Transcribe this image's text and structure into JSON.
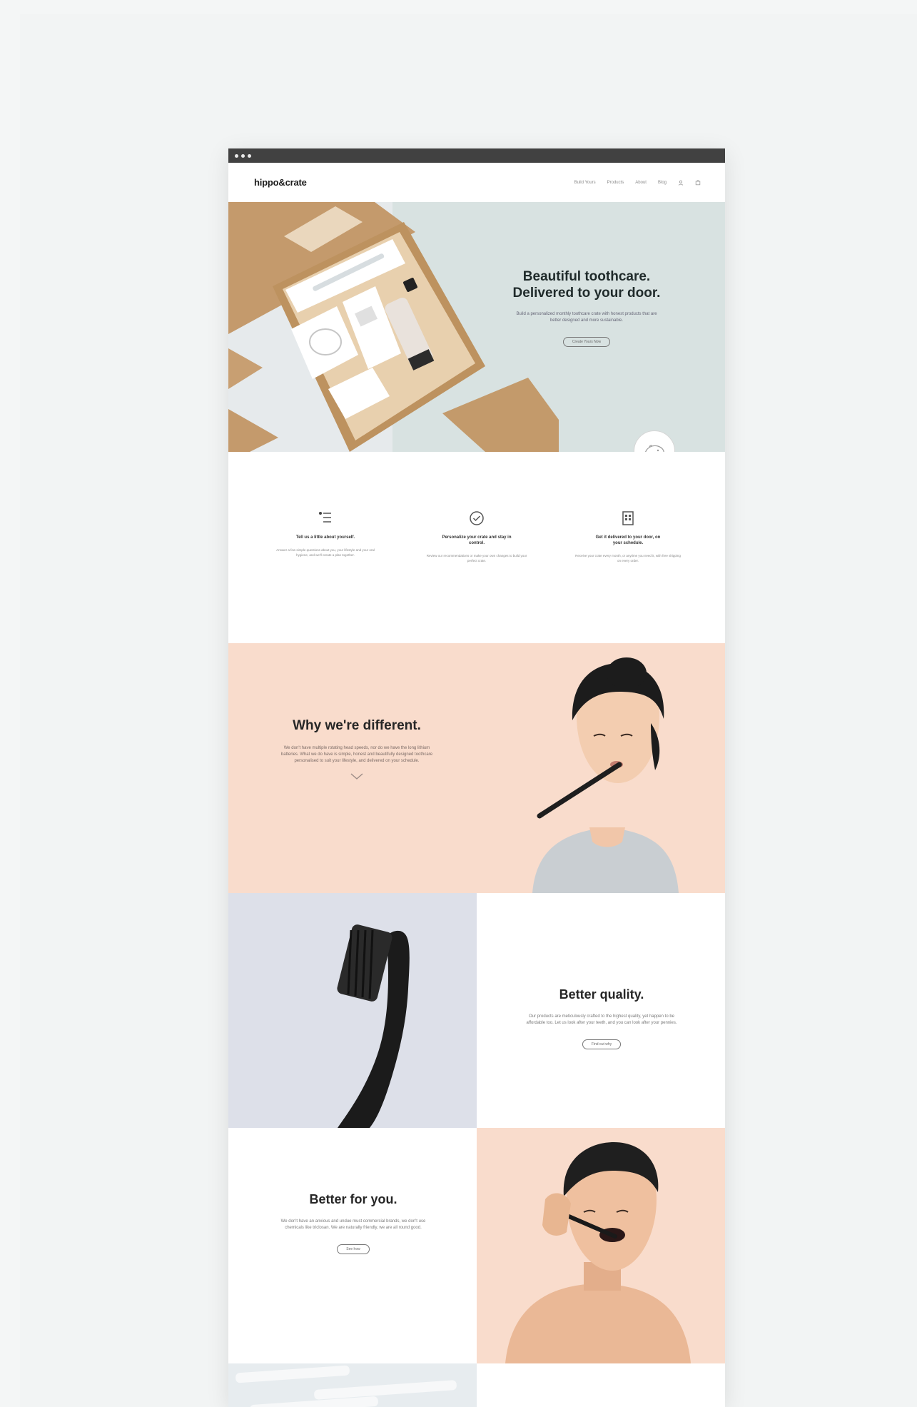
{
  "nav": {
    "logo": "hippo&crate",
    "links": [
      "Build Yours",
      "Products",
      "About",
      "Blog"
    ]
  },
  "hero": {
    "title_line1": "Beautiful toothcare.",
    "title_line2": "Delivered to your door.",
    "subtitle": "Build a personalized monthly toothcare crate with honest products that are better designed and more sustainable.",
    "cta": "Create Yours Now"
  },
  "steps": [
    {
      "icon": "list-icon",
      "title": "Tell us a little about yourself.",
      "desc": "Answer a few simple questions about you, your lifestyle and your oral hygiene, and we'll create a plan together."
    },
    {
      "icon": "check-circle-icon",
      "title": "Personalize your crate and stay in control.",
      "desc": "Review our recommendations or make your own changes to build your perfect crate."
    },
    {
      "icon": "calendar-icon",
      "title": "Get it delivered to your door, on your schedule.",
      "desc": "Receive your crate every month, or anytime you need it, with free shipping on every order."
    }
  ],
  "different": {
    "title": "Why we're different.",
    "body": "We don't have multiple rotating head speeds, nor do we have the long lithium batteries. What we do have is simple, honest and beautifully designed toothcare personalised to suit your lifestyle, and delivered on your schedule."
  },
  "quality": {
    "title": "Better quality.",
    "body": "Our products are meticulously crafted to the highest quality, yet happen to be affordable too. Let us look after your teeth, and you can look after your pennies.",
    "cta": "Find out why"
  },
  "for_you": {
    "title": "Better for you.",
    "body": "We don't have an anxious and undue must commercial brands, we don't use chemicals like triclosan. We are naturally friendly, we are all round good.",
    "cta": "See how"
  },
  "colors": {
    "hero_bg": "#d8e2e1",
    "peach": "#f9dccc",
    "lavender": "#dde0e9",
    "chrome": "#414141"
  }
}
